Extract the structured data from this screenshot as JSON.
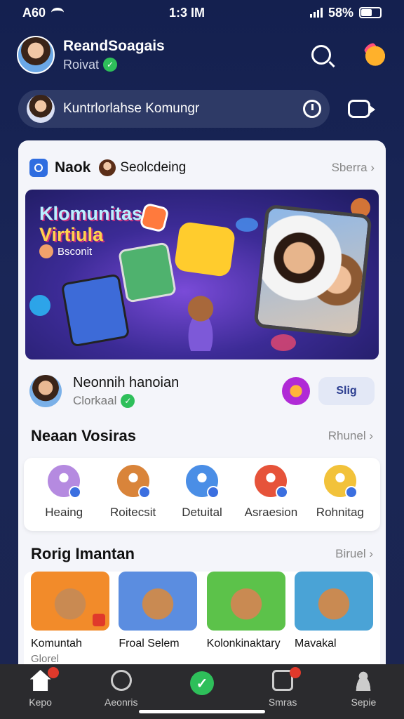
{
  "status_bar": {
    "carrier": "A60",
    "time": "1:3 IM",
    "battery": "58%",
    "battery_level": 0.58
  },
  "profile": {
    "name": "ReandSoagais",
    "status": "Roivat",
    "avatar_icon": "avatar-icon"
  },
  "search": {
    "placeholder": "Kuntrlorlahse Komungr"
  },
  "card": {
    "title": "Naok",
    "subtitle": "Seolcdeing",
    "link": "Sberra"
  },
  "banner": {
    "title_line1": "Klomunitas",
    "title_line2": "Virtiula",
    "sub": "Bsconit"
  },
  "creator": {
    "name": "Neonnih hanoian",
    "meta": "Clorkaal",
    "join_label": "Slig"
  },
  "section_recent": {
    "title": "Neaan Vosiras",
    "link": "Rhunel"
  },
  "categories": [
    {
      "label": "Heaing",
      "color": "#b58ae0"
    },
    {
      "label": "Roitecsit",
      "color": "#d9843a"
    },
    {
      "label": "Detuital",
      "color": "#4a8ee6"
    },
    {
      "label": "Asraesion",
      "color": "#e6533a"
    },
    {
      "label": "Rohnitag",
      "color": "#f2c23a"
    }
  ],
  "section_trending": {
    "title": "Rorig Imantan",
    "link": "Biruel"
  },
  "games": [
    {
      "label": "Komuntah",
      "meta": "Glorel",
      "color": "#f28b2a"
    },
    {
      "label": "Froal Selem",
      "meta": "",
      "color": "#5b8de0"
    },
    {
      "label": "Kolonkinaktary",
      "meta": "",
      "color": "#5cc24a"
    },
    {
      "label": "Mavakal",
      "meta": "",
      "color": "#4aa3d6"
    }
  ],
  "bottom_nav": [
    {
      "label": "Kepo",
      "icon": "home-icon"
    },
    {
      "label": "Aeonris",
      "icon": "explore-icon"
    },
    {
      "label": "",
      "icon": "check-icon"
    },
    {
      "label": "Smras",
      "icon": "chat-icon"
    },
    {
      "label": "Sepie",
      "icon": "profile-icon"
    }
  ],
  "colors": {
    "background": "#1a2657",
    "accent_green": "#2ebf5a",
    "badge_red": "#e0392b"
  }
}
